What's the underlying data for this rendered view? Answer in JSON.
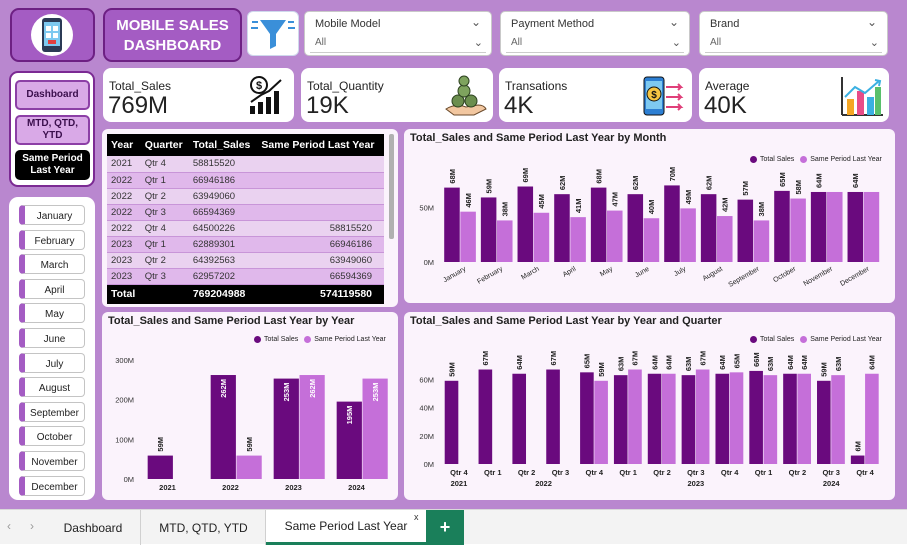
{
  "header": {
    "title_line1": "MOBILE SALES",
    "title_line2": "DASHBOARD"
  },
  "icons": {
    "logo": "phone-sales-icon",
    "filter": "funnel-filter-icon",
    "sales": "dollar-bar-chart-icon",
    "quantity": "coin-stack-hand-icon",
    "transactions": "phone-payment-icon",
    "average": "bar-chart-growth-icon"
  },
  "filters": [
    {
      "label": "Mobile Model",
      "value": "All"
    },
    {
      "label": "Payment Method",
      "value": "All"
    },
    {
      "label": "Brand",
      "value": "All"
    }
  ],
  "nav": {
    "dashboard": "Dashboard",
    "mtd": "MTD, QTD, YTD",
    "same_line1": "Same Period",
    "same_line2": "Last Year"
  },
  "months": [
    "January",
    "February",
    "March",
    "April",
    "May",
    "June",
    "July",
    "August",
    "September",
    "October",
    "November",
    "December"
  ],
  "kpis": [
    {
      "label": "Total_Sales",
      "value": "769M"
    },
    {
      "label": "Total_Quantity",
      "value": "19K"
    },
    {
      "label": "Transations",
      "value": "4K"
    },
    {
      "label": "Average",
      "value": "40K"
    }
  ],
  "table": {
    "headers": [
      "Year",
      "Quarter",
      "Total_Sales",
      "Same Period Last Year"
    ],
    "rows": [
      [
        "2021",
        "Qtr 4",
        "58815520",
        ""
      ],
      [
        "2022",
        "Qtr 1",
        "66946186",
        ""
      ],
      [
        "2022",
        "Qtr 2",
        "63949060",
        ""
      ],
      [
        "2022",
        "Qtr 3",
        "66594369",
        ""
      ],
      [
        "2022",
        "Qtr 4",
        "64500226",
        "58815520"
      ],
      [
        "2023",
        "Qtr 1",
        "62889301",
        "66946186"
      ],
      [
        "2023",
        "Qtr 2",
        "64392563",
        "63949060"
      ],
      [
        "2023",
        "Qtr 3",
        "62957202",
        "66594369"
      ]
    ],
    "total": [
      "Total",
      "",
      "769204988",
      "574119580"
    ]
  },
  "colors": {
    "total_sales": "#6a0a7e",
    "same_period": "#c56fd9",
    "panel_bg": "#fbf3fc",
    "dashboard_bg": "#b987cf"
  },
  "tabs": [
    "Dashboard",
    "MTD, QTD, YTD",
    "Same Period Last Year"
  ],
  "tab_close": "x",
  "tab_add": "+",
  "chart_data": [
    {
      "type": "bar",
      "title": "Total_Sales and Same Period Last Year by Month",
      "categories": [
        "January",
        "February",
        "March",
        "April",
        "May",
        "June",
        "July",
        "August",
        "September",
        "October",
        "November",
        "December"
      ],
      "y_ticks": [
        "50M",
        "0M"
      ],
      "ylim": [
        0,
        85
      ],
      "series": [
        {
          "name": "Total Sales",
          "values": [
            68,
            59,
            69,
            62,
            68,
            62,
            70,
            62,
            57,
            65,
            64,
            64
          ],
          "labels": [
            "68M",
            "59M",
            "69M",
            "62M",
            "68M",
            "62M",
            "70M",
            "62M",
            "57M",
            "65M",
            "64M",
            "64M"
          ]
        },
        {
          "name": "Same Period Last Year",
          "values": [
            46,
            38,
            45,
            41,
            47,
            40,
            49,
            42,
            38,
            58,
            64,
            64
          ],
          "labels": [
            "46M",
            "38M",
            "45M",
            "41M",
            "47M",
            "40M",
            "49M",
            "42M",
            "38M",
            "58M",
            "",
            ""
          ]
        }
      ]
    },
    {
      "type": "bar",
      "title": "Total_Sales and Same Period Last Year by Year",
      "categories": [
        "2021",
        "2022",
        "2023",
        "2024"
      ],
      "y_ticks": [
        "300M",
        "200M",
        "100M",
        "0M"
      ],
      "ylim": [
        0,
        320
      ],
      "series": [
        {
          "name": "Total Sales",
          "values": [
            59,
            262,
            253,
            195
          ],
          "labels": [
            "59M",
            "262M",
            "253M",
            "195M"
          ]
        },
        {
          "name": "Same Period Last Year",
          "values": [
            null,
            59,
            262,
            253
          ],
          "labels": [
            "",
            "59M",
            "262M",
            "253M"
          ]
        }
      ]
    },
    {
      "type": "bar",
      "title": "Total_Sales and Same Period Last Year by Year and Quarter",
      "categories": [
        "Qtr 4",
        "Qtr 1",
        "Qtr 2",
        "Qtr 3",
        "Qtr 4",
        "Qtr 1",
        "Qtr 2",
        "Qtr 3",
        "Qtr 4",
        "Qtr 1",
        "Qtr 2",
        "Qtr 3",
        "Qtr 4"
      ],
      "years": [
        "2021",
        "2022",
        "2023",
        "2024"
      ],
      "y_ticks": [
        "60M",
        "40M",
        "20M",
        "0M"
      ],
      "ylim": [
        0,
        78
      ],
      "series": [
        {
          "name": "Total Sales",
          "values": [
            59,
            67,
            64,
            67,
            65,
            63,
            64,
            63,
            64,
            66,
            64,
            59,
            6
          ],
          "labels": [
            "59M",
            "67M",
            "64M",
            "67M",
            "65M",
            "63M",
            "64M",
            "63M",
            "64M",
            "66M",
            "64M",
            "59M",
            "6M"
          ]
        },
        {
          "name": "Same Period Last Year",
          "values": [
            null,
            null,
            null,
            null,
            59,
            67,
            64,
            67,
            65,
            63,
            64,
            63,
            64
          ],
          "labels": [
            "",
            "",
            "",
            "",
            "59M",
            "67M",
            "64M",
            "67M",
            "65M",
            "63M",
            "64M",
            "63M",
            "64M"
          ]
        }
      ]
    }
  ]
}
